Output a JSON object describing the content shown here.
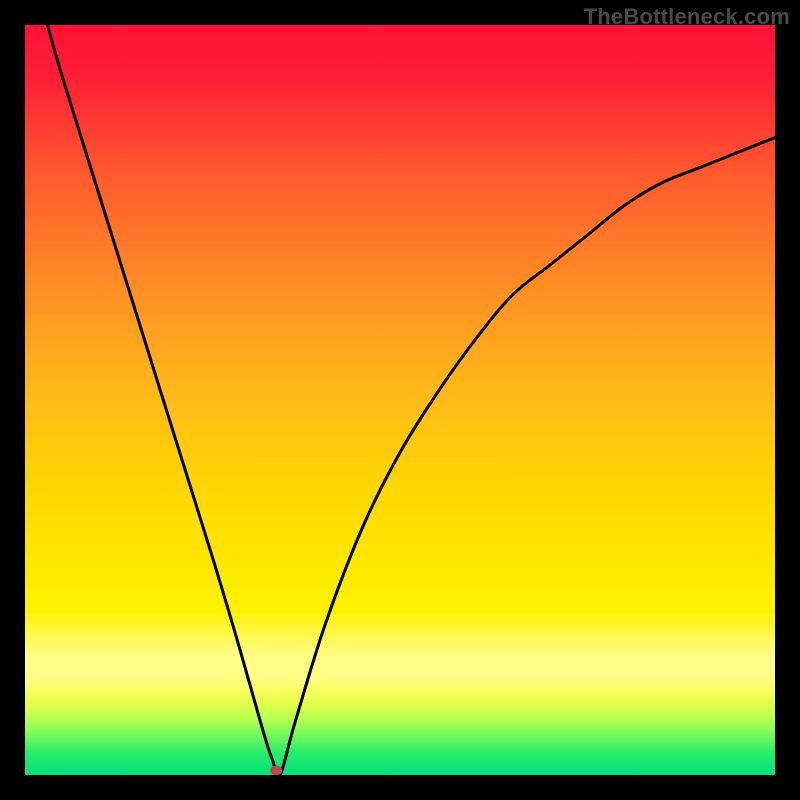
{
  "watermark": "TheBottleneck.com",
  "chart_data": {
    "type": "line",
    "title": "",
    "xlabel": "",
    "ylabel": "",
    "xlim": [
      0,
      100
    ],
    "ylim": [
      0,
      100
    ],
    "grid": false,
    "legend": false,
    "series": [
      {
        "name": "curve",
        "x": [
          3,
          5,
          10,
          15,
          20,
          25,
          28,
          30,
          32,
          33,
          34,
          36,
          40,
          45,
          50,
          55,
          60,
          65,
          70,
          75,
          80,
          85,
          90,
          95,
          100
        ],
        "y": [
          100,
          93,
          77,
          61,
          45,
          29,
          19,
          12,
          5,
          2,
          0,
          7,
          20,
          33,
          43,
          51,
          58,
          64,
          68,
          72,
          76,
          79,
          81,
          83,
          85
        ]
      }
    ],
    "marker": {
      "x": 33.5,
      "y": 0.6,
      "color": "#bc4b3f",
      "rx": 6,
      "ry": 5
    },
    "background_gradient": {
      "top_color": "#fe1239",
      "mid_color": "#ffd400",
      "green_edge": "#00e35a",
      "green_bottom": "#00e080"
    }
  }
}
